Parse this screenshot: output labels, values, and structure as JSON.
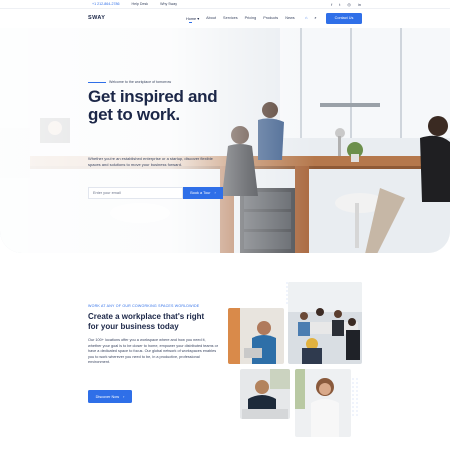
{
  "topbar": {
    "phone": "+1 212-864-2786",
    "help": "Help Desk",
    "why": "Why Sway",
    "social_icons": [
      "facebook-icon",
      "twitter-icon",
      "instagram-icon",
      "linkedin-icon"
    ],
    "social_glyphs": [
      "f",
      "t",
      "◎",
      "in"
    ]
  },
  "nav": {
    "logo": "SWAY",
    "items": [
      "Home",
      "About",
      "Services",
      "Pricing",
      "Products",
      "News"
    ],
    "active_suffix": "▾",
    "cart_glyph": "⌂",
    "search_glyph": "⌕",
    "cta": "Contact Us"
  },
  "hero": {
    "eyebrow": "Welcome to the workplace of tomorrow",
    "title": "Get inspired and get to work.",
    "subtitle": "Whether you're an established enterprise or a startup, discover flexible spaces and solutions to move your business forward.",
    "email_placeholder": "Enter your email",
    "button": "Book a Tour",
    "button_arrow": "›"
  },
  "section": {
    "kicker": "WORK AT ANY OF OUR COWORKING SPACES WORLDWIDE",
    "title": "Create a workplace that's right for your business today",
    "body": "Our 100+ locations offer you a workspace where and how you need it, whether your goal is to be closer to home, empower your distributed teams or have a dedicated space to focus. Our global network of workspaces enables you to work wherever you need to be, in a productive, professional environment.",
    "button": "Discover Now",
    "button_arrow": "›"
  },
  "colors": {
    "accent": "#2f6fe8",
    "heading": "#1c2748",
    "text": "#3a4560"
  }
}
